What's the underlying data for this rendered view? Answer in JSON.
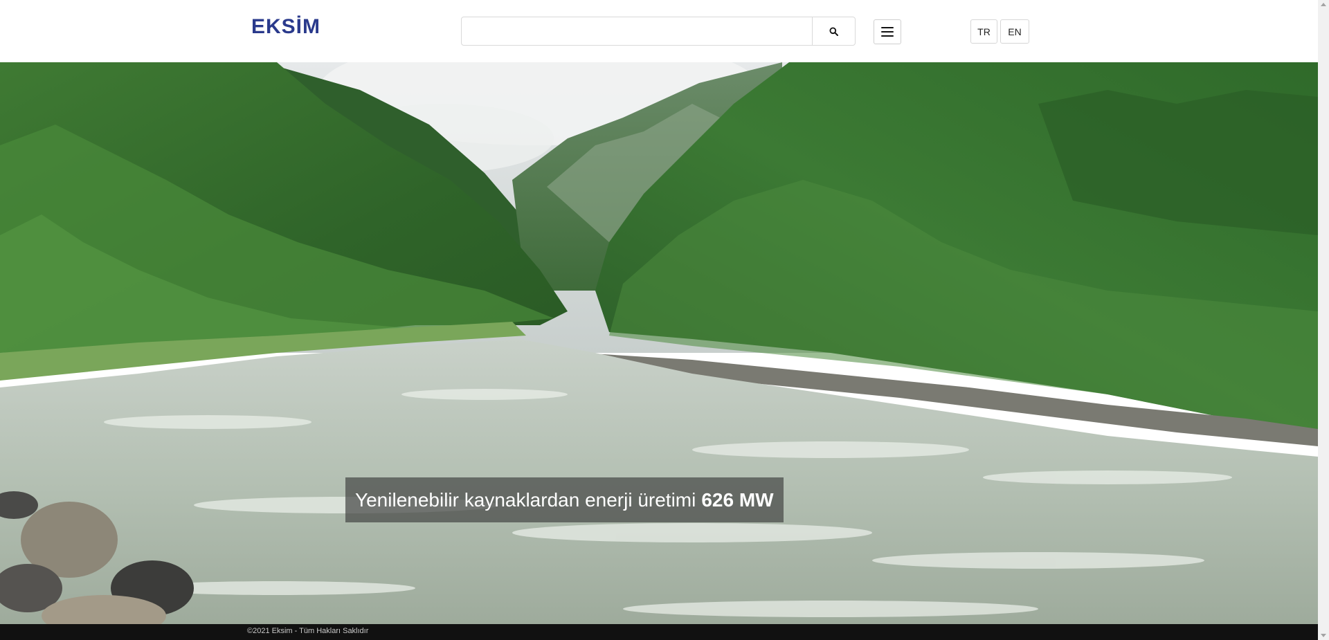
{
  "header": {
    "logo_text": "EKSİM",
    "search": {
      "value": "",
      "placeholder": "",
      "button_icon": "search-icon"
    },
    "menu_icon": "hamburger-menu-icon",
    "languages": [
      {
        "label": "TR"
      },
      {
        "label": "EN"
      }
    ]
  },
  "hero": {
    "image": "river-valley-forest-photo",
    "caption_text": "Yenilenebilir kaynaklardan enerji üretimi",
    "caption_value": "626 MW"
  },
  "footer": {
    "copyright": "©2021 Eksim - Tüm Hakları Saklıdır"
  },
  "colors": {
    "brand": "#2a3a8c",
    "footer_bg": "#111111",
    "caption_bg": "#464846"
  }
}
